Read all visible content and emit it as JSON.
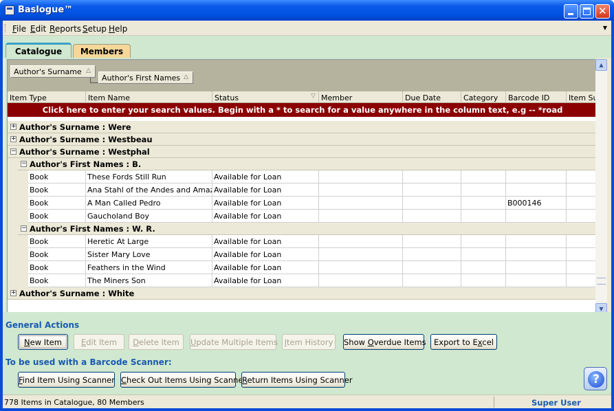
{
  "window": {
    "title": "Baslogue™"
  },
  "menu": [
    {
      "accel": "F",
      "rest": "ile"
    },
    {
      "accel": "E",
      "rest": "dit"
    },
    {
      "accel": "R",
      "rest": "eports"
    },
    {
      "accel": "S",
      "rest": "etup"
    },
    {
      "accel": "H",
      "rest": "elp"
    }
  ],
  "tabs": {
    "catalogue": "Catalogue",
    "members": "Members"
  },
  "grid": {
    "group_by": [
      "Author's Surname",
      "Author's First Names"
    ],
    "columns": [
      "Item Type",
      "Item Name",
      "Status",
      "Member",
      "Due Date",
      "Category",
      "Barcode ID",
      "Item Sub"
    ],
    "search_hint": "Click here to enter your search values.  Begin with a * to search for a value anywhere in the column text, e.g --  *road",
    "groups": [
      {
        "label": "Author's Surname : Were",
        "sign": "+"
      },
      {
        "label": "Author's Surname : Westbeau",
        "sign": "+"
      },
      {
        "label": "Author's Surname : Westphal",
        "sign": "−"
      },
      {
        "label": "Author's First Names : B.",
        "sign": "−"
      },
      {
        "label": "Author's First Names : W. R.",
        "sign": "−"
      },
      {
        "label": "Author's Surname : White",
        "sign": "+"
      }
    ],
    "rows_b": [
      [
        "Book",
        "These Fords Still Run",
        "Available for Loan",
        "",
        "",
        "",
        "",
        ""
      ],
      [
        "Book",
        "Ana Stahl of the Andes and Amazon",
        "Available for Loan",
        "",
        "",
        "",
        "",
        ""
      ],
      [
        "Book",
        "A Man Called Pedro",
        "Available for Loan",
        "",
        "",
        "",
        "B000146",
        ""
      ],
      [
        "Book",
        "Gaucholand Boy",
        "Available for Loan",
        "",
        "",
        "",
        "",
        ""
      ]
    ],
    "rows_wr": [
      [
        "Book",
        "Heretic At Large",
        "Available for Loan",
        "",
        "",
        "",
        "",
        ""
      ],
      [
        "Book",
        "Sister Mary Love",
        "Available for Loan",
        "",
        "",
        "",
        "",
        ""
      ],
      [
        "Book",
        "Feathers in the Wind",
        "Available for Loan",
        "",
        "",
        "",
        "",
        ""
      ],
      [
        "Book",
        "The Miners Son",
        "Available for Loan",
        "",
        "",
        "",
        "",
        ""
      ]
    ]
  },
  "general_actions": {
    "title": "General Actions",
    "buttons": [
      {
        "accel": "N",
        "rest": "ew Item",
        "pre": "",
        "enabled": true
      },
      {
        "pre": "",
        "accel": "E",
        "rest": "dit Item",
        "enabled": false
      },
      {
        "pre": "",
        "accel": "D",
        "rest": "elete Item",
        "enabled": false
      },
      {
        "pre": "",
        "accel": "U",
        "rest": "pdate Multiple Items",
        "enabled": false
      },
      {
        "pre": "",
        "accel": "I",
        "rest": "tem History",
        "enabled": false
      },
      {
        "pre": "Show ",
        "accel": "O",
        "rest": "verdue Items",
        "enabled": true
      },
      {
        "pre": "Export to E",
        "accel": "x",
        "rest": "cel",
        "enabled": true
      }
    ]
  },
  "scanner_actions": {
    "title": "To be used with a Barcode Scanner:",
    "buttons": [
      {
        "pre": "",
        "accel": "F",
        "rest": "ind Item Using Scanner"
      },
      {
        "pre": "",
        "accel": "C",
        "rest": "heck Out Items Using Scanner"
      },
      {
        "pre": "",
        "accel": "R",
        "rest": "eturn Items Using Scanner"
      }
    ]
  },
  "help_label": "?",
  "status": {
    "left": "778 Items in Catalogue, 80 Members",
    "user": "Super User"
  }
}
